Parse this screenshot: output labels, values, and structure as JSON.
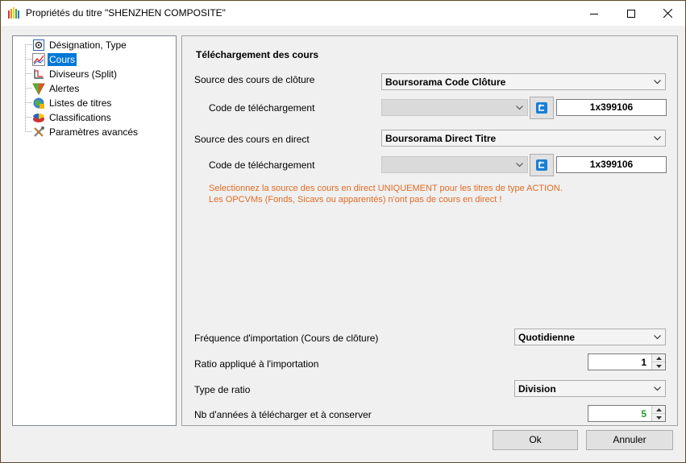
{
  "window": {
    "title": "Propriétés du titre \"SHENZHEN COMPOSITE\""
  },
  "tree": {
    "items": [
      {
        "label": "Désignation, Type",
        "icon": "designation-icon"
      },
      {
        "label": "Cours",
        "icon": "chart-icon",
        "selected": true
      },
      {
        "label": "Diviseurs (Split)",
        "icon": "split-icon"
      },
      {
        "label": "Alertes",
        "icon": "alert-icon"
      },
      {
        "label": "Listes de titres",
        "icon": "list-icon"
      },
      {
        "label": "Classifications",
        "icon": "classification-icon"
      },
      {
        "label": "Paramètres avancés",
        "icon": "tools-icon"
      }
    ]
  },
  "main": {
    "section_title": "Téléchargement des cours",
    "closing": {
      "label": "Source des cours de clôture",
      "source_value": "Boursorama Code Clôture",
      "code_label": "Code de téléchargement",
      "code_combo_value": "",
      "code_value": "1x399106"
    },
    "live": {
      "label": "Source des cours en direct",
      "source_value": "Boursorama Direct Titre",
      "code_label": "Code de téléchargement",
      "code_combo_value": "",
      "code_value": "1x399106"
    },
    "warning_line1": "Selectionnez la source des cours en direct UNIQUEMENT pour les titres de type ACTION.",
    "warning_line2": "Les OPCVMs (Fonds, Sicavs ou apparentés) n'ont pas de cours en direct !",
    "frequency": {
      "label": "Fréquence d'importation (Cours de clôture)",
      "value": "Quotidienne"
    },
    "ratio": {
      "label": "Ratio appliqué à l'importation",
      "value": "1"
    },
    "ratio_type": {
      "label": "Type de ratio",
      "value": "Division"
    },
    "years": {
      "label": "Nb d'années à télécharger et à conserver",
      "value": "5"
    }
  },
  "buttons": {
    "ok": "Ok",
    "cancel": "Annuler"
  },
  "colors": {
    "selection": "#0078d7",
    "warning": "#e06b25",
    "years_value": "#2a9a2a",
    "refresh_icon": "#1a7fd4"
  }
}
